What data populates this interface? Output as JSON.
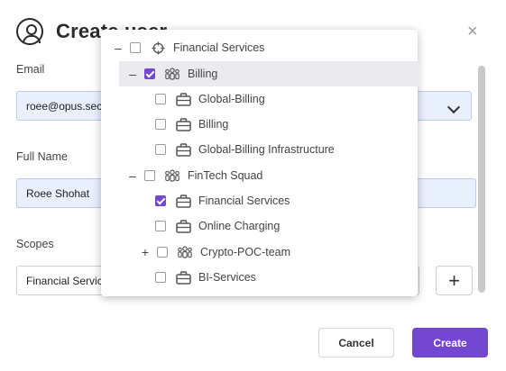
{
  "dialog": {
    "title": "Create user",
    "close_label": "×"
  },
  "form": {
    "email": {
      "label": "Email",
      "value": "roee@opus.secu"
    },
    "full_name": {
      "label": "Full Name",
      "value": "Roee Shohat"
    },
    "scopes": {
      "label": "Scopes",
      "value": "Financial Servic",
      "add_label": "+"
    }
  },
  "buttons": {
    "cancel": "Cancel",
    "create": "Create"
  },
  "tree": {
    "items": [
      {
        "label": "Financial Services",
        "toggle": "–",
        "checked": false,
        "icon": "crosshair-icon"
      },
      {
        "label": "Billing",
        "toggle": "–",
        "checked": true,
        "icon": "team-icon",
        "highlighted": true
      },
      {
        "label": "Global-Billing",
        "toggle": "",
        "checked": false,
        "icon": "briefcase-icon"
      },
      {
        "label": "Billing",
        "toggle": "",
        "checked": false,
        "icon": "briefcase-icon"
      },
      {
        "label": "Global-Billing Infrastructure",
        "toggle": "",
        "checked": false,
        "icon": "briefcase-icon"
      },
      {
        "label": "FinTech Squad",
        "toggle": "–",
        "checked": false,
        "icon": "team-icon"
      },
      {
        "label": "Financial Services",
        "toggle": "",
        "checked": true,
        "icon": "briefcase-icon"
      },
      {
        "label": "Online Charging",
        "toggle": "",
        "checked": false,
        "icon": "briefcase-icon"
      },
      {
        "label": "Crypto-POC-team",
        "toggle": "+",
        "checked": false,
        "icon": "team-icon"
      },
      {
        "label": "BI-Services",
        "toggle": "",
        "checked": false,
        "icon": "briefcase-icon"
      }
    ]
  },
  "colors": {
    "accent": "#7447d1",
    "filled_field": "#e8effd"
  }
}
